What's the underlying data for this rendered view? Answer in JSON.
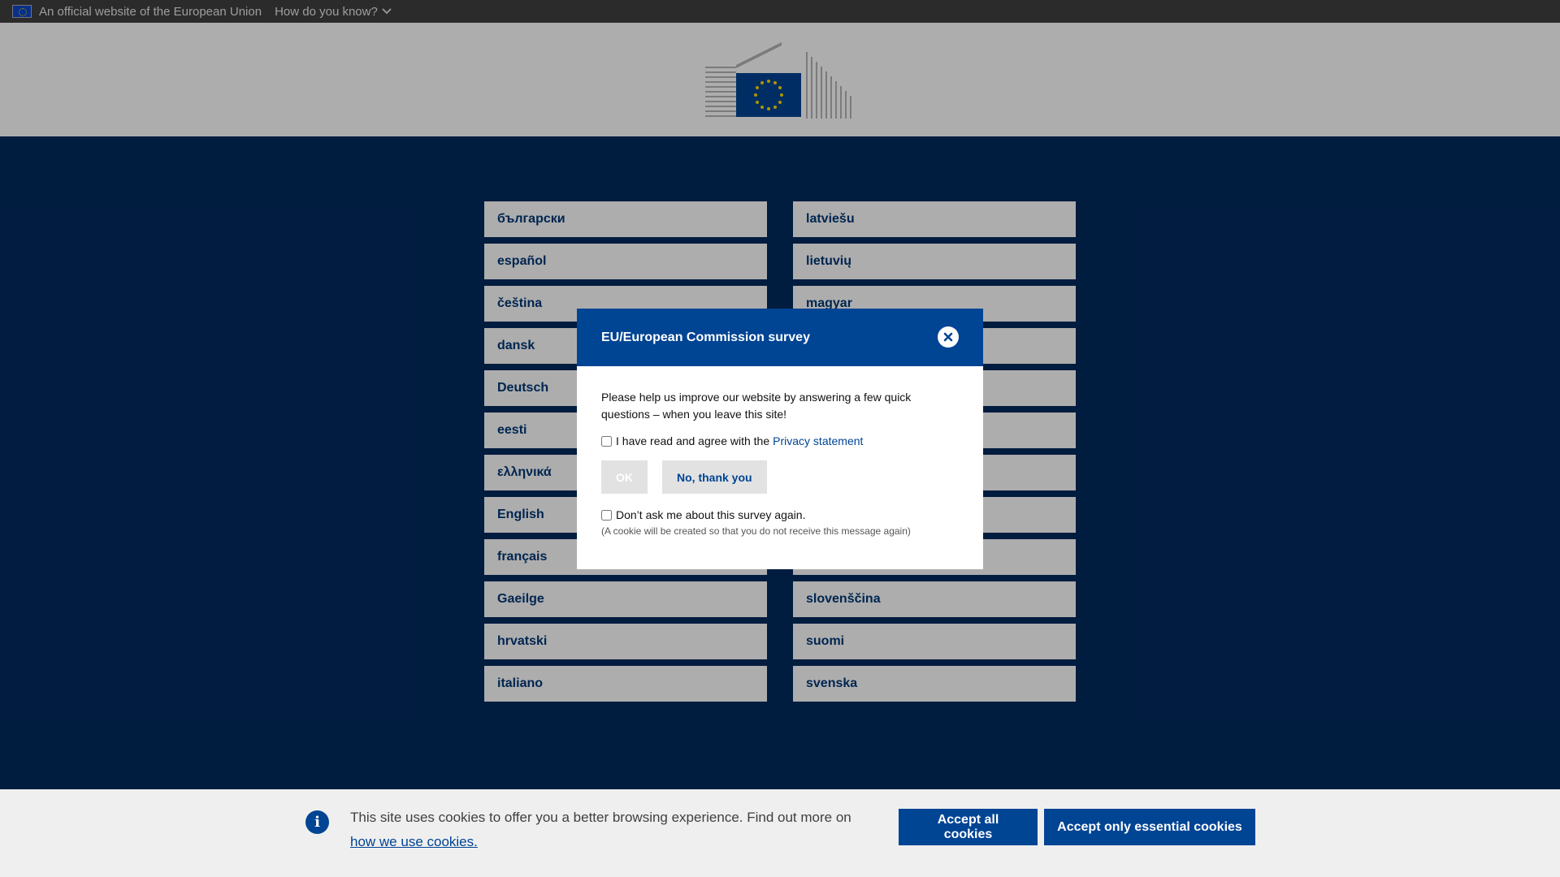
{
  "eu_bar": {
    "official_text": "An official website of the European Union",
    "how_text": "How do you know?"
  },
  "languages": {
    "left": [
      "български",
      "español",
      "čeština",
      "dansk",
      "Deutsch",
      "eesti",
      "ελληνικά",
      "English",
      "français",
      "Gaeilge",
      "hrvatski",
      "italiano"
    ],
    "right": [
      "latviešu",
      "lietuvių",
      "magyar",
      "",
      "",
      "",
      "",
      "",
      "",
      "slovenščina",
      "suomi",
      "svenska"
    ]
  },
  "survey": {
    "title": "EU/European Commission survey",
    "text": "Please help us improve our website by answering a few quick questions – when you leave this site!",
    "agree_label": "I have read and agree with the",
    "privacy_link": "Privacy statement",
    "ok_label": "OK",
    "no_label": "No, thank you",
    "dont_ask_label": "Don’t ask me about this survey again.",
    "cookie_note": "(A cookie will be created so that you do not receive this message again)"
  },
  "cookie_banner": {
    "text": "This site uses cookies to offer you a better browsing experience. Find out more on",
    "link_text": "how we use cookies.",
    "accept_all": "Accept all cookies",
    "accept_essential": "Accept only essential cookies"
  },
  "colors": {
    "eu_blue": "#004494",
    "page_bg": "#012a5e",
    "flag_yellow": "#ffdd00"
  }
}
